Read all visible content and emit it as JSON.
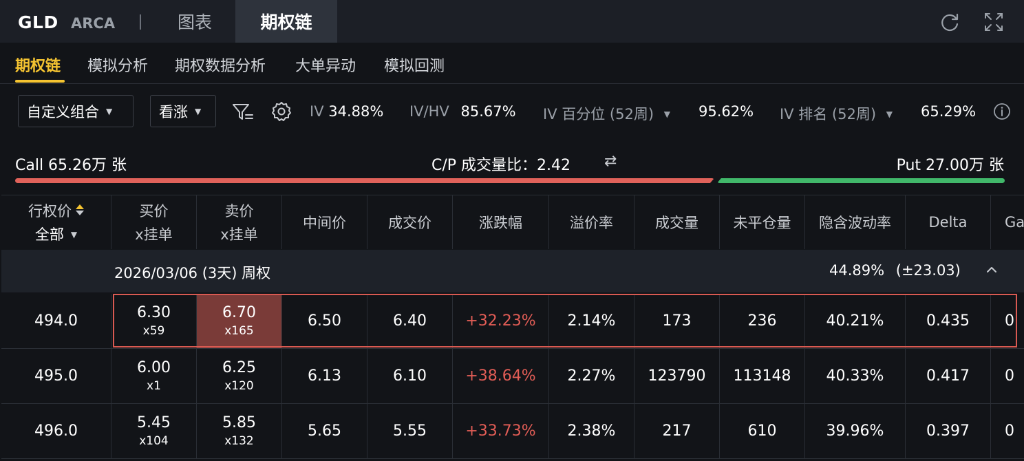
{
  "header": {
    "symbol": "GLD",
    "exchange": "ARCA",
    "tabs": [
      {
        "label": "图表",
        "active": false
      },
      {
        "label": "期权链",
        "active": true
      }
    ]
  },
  "subtabs": [
    {
      "label": "期权链",
      "active": true
    },
    {
      "label": "模拟分析",
      "active": false
    },
    {
      "label": "期权数据分析",
      "active": false
    },
    {
      "label": "大单异动",
      "active": false
    },
    {
      "label": "模拟回测",
      "active": false
    }
  ],
  "filters": {
    "combo_select": "自定义组合",
    "direction_select": "看涨"
  },
  "metrics": {
    "iv_label": "IV",
    "iv_value": "34.88%",
    "ivhv_label": "IV/HV",
    "ivhv_value": "85.67%",
    "iv_pct_label": "IV 百分位 (52周)",
    "iv_pct_value": "95.62%",
    "iv_rank_label": "IV 排名 (52周)",
    "iv_rank_value": "65.29%"
  },
  "volume": {
    "call_text": "Call 65.26万 张",
    "ratio_text": "C/P 成交量比：2.42",
    "put_text": "Put 27.00万 张",
    "call_ratio": 0.707,
    "colors": {
      "call": "#e0625a",
      "put": "#41b86a"
    }
  },
  "table": {
    "headers": {
      "strike": "行权价",
      "strike_filter": "全部",
      "bid_1": "买价",
      "bid_2": "x挂单",
      "ask_1": "卖价",
      "ask_2": "x挂单",
      "mid": "中间价",
      "last": "成交价",
      "change": "涨跌幅",
      "premium": "溢价率",
      "volume": "成交量",
      "oi": "未平仓量",
      "iv": "隐含波动率",
      "delta": "Delta",
      "gamma_partial": "Ga"
    },
    "expiry": {
      "label": "2026/03/06 (3天) 周权",
      "iv": "44.89%",
      "move": "(±23.03)"
    },
    "rows": [
      {
        "strike": "494.0",
        "bid": "6.30",
        "bid_size": "x59",
        "ask": "6.70",
        "ask_size": "x165",
        "mid": "6.50",
        "last": "6.40",
        "change": "+32.23%",
        "premium": "2.14%",
        "volume": "173",
        "oi": "236",
        "iv": "40.21%",
        "delta": "0.435",
        "gamma": "0"
      },
      {
        "strike": "495.0",
        "bid": "6.00",
        "bid_size": "x1",
        "ask": "6.25",
        "ask_size": "x120",
        "mid": "6.13",
        "last": "6.10",
        "change": "+38.64%",
        "premium": "2.27%",
        "volume": "123790",
        "oi": "113148",
        "iv": "40.33%",
        "delta": "0.417",
        "gamma": "0"
      },
      {
        "strike": "496.0",
        "bid": "5.45",
        "bid_size": "x104",
        "ask": "5.85",
        "ask_size": "x132",
        "mid": "5.65",
        "last": "5.55",
        "change": "+33.73%",
        "premium": "2.38%",
        "volume": "217",
        "oi": "610",
        "iv": "39.96%",
        "delta": "0.397",
        "gamma": "0"
      }
    ]
  },
  "colors": {
    "accent": "#f5c431",
    "up": "#e25d56",
    "highlight": "#7a3b38"
  }
}
